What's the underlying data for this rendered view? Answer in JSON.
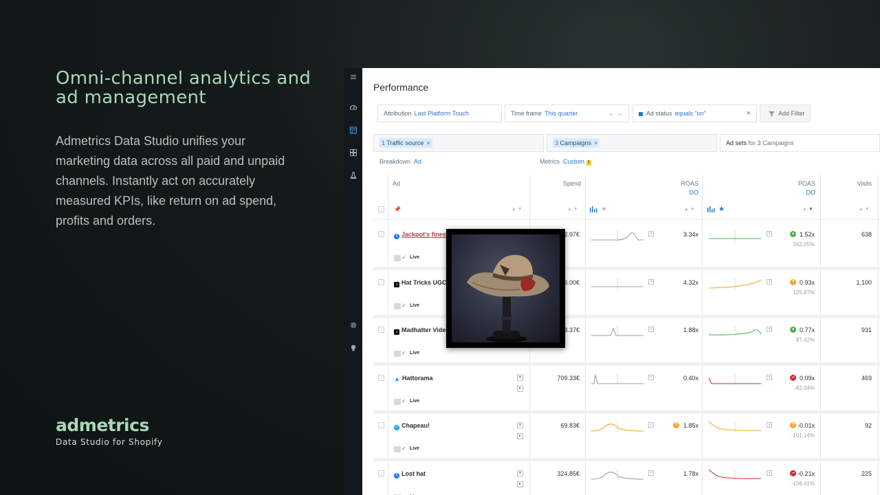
{
  "promo": {
    "headline": "Omni-channel analytics and ad management",
    "description": "Admetrics Data Studio unifies your marketing data across all paid and unpaid channels. Instantly act on accurately measured KPIs, like return on ad spend, profits and orders.",
    "brand_name": "admetrics",
    "brand_tagline": "Data Studio for Shopify",
    "accent_color": "#a8d8b9"
  },
  "sidebar": {
    "icons": [
      "menu-icon",
      "dashboard-icon",
      "calendar-icon",
      "grid-icon",
      "lab-icon",
      "settings-icon",
      "lightbulb-icon"
    ]
  },
  "page": {
    "title": "Performance"
  },
  "filters": {
    "attribution_label": "Attribution",
    "attribution_value": "Last Platform Touch",
    "timeframe_label": "Time frame",
    "timeframe_value": "This quarter",
    "timeframe_arrows": "← →",
    "adstatus_label": "Ad status",
    "adstatus_value": "equals \"on\"",
    "clear_symbol": "×",
    "add_filter_label": "Add Filter"
  },
  "selectors": {
    "traffic_count": "1",
    "traffic_label": "Traffic source",
    "campaigns_count": "3",
    "campaigns_label": "Campaigns",
    "adsets_label": "Ad sets",
    "adsets_for": "for",
    "adsets_count": "3",
    "adsets_campaigns": "Campaigns",
    "remove_symbol": "×"
  },
  "options": {
    "breakdown_label": "Breakdown",
    "breakdown_value": "Ad",
    "metrics_label": "Metrics",
    "metrics_value": "Custom",
    "warning_symbol": "!"
  },
  "table": {
    "columns": {
      "ad": "Ad",
      "spend": "Spend",
      "roas": "ROAS",
      "roas_sub": "DO",
      "poas": "POAS",
      "poas_sub": "DO",
      "visits": "Visits"
    },
    "live_label": "Live",
    "rows": [
      {
        "name": "Jackpot's finest",
        "platform": "facebook",
        "link": true,
        "spend": "482.97€",
        "roas": "3.34x",
        "roas_badge": "",
        "poas": "1.52x",
        "poas_pct": "342.05%",
        "poas_status": "green",
        "visits": "638"
      },
      {
        "name": "Hat Tricks UGC",
        "platform": "tiktok",
        "link": false,
        "spend": "406.00€",
        "roas": "4.32x",
        "roas_badge": "",
        "poas": "0.93x",
        "poas_pct": "125.87%",
        "poas_status": "orange",
        "visits": "1,100"
      },
      {
        "name": "Madhatter Video",
        "platform": "tiktok",
        "link": false,
        "spend": "398.37€",
        "roas": "1.88x",
        "roas_badge": "",
        "poas": "0.77x",
        "poas_pct": "87.42%",
        "poas_status": "green",
        "visits": "931"
      },
      {
        "name": "Hattorama",
        "platform": "google",
        "link": false,
        "spend": "709.33€",
        "roas": "0.40x",
        "roas_badge": "",
        "poas": "0.09x",
        "poas_pct": "-82.04%",
        "poas_status": "red",
        "visits": "469"
      },
      {
        "name": "Chapeau!",
        "platform": "twitter",
        "link": false,
        "spend": "69.83€",
        "roas": "1.85x",
        "roas_badge": "orange",
        "poas": "-0.01x",
        "poas_pct": "-101.14%",
        "poas_status": "orange",
        "visits": "92"
      },
      {
        "name": "Lost hat",
        "platform": "facebook",
        "link": false,
        "spend": "324.85€",
        "roas": "1.78x",
        "roas_badge": "",
        "poas": "-0.21x",
        "poas_pct": "-138.41%",
        "poas_status": "red",
        "visits": "225"
      }
    ]
  },
  "colors": {
    "link_blue": "#2f74c8",
    "link_red": "#d0304b",
    "status_green": "#4caf50",
    "status_orange": "#f5a623",
    "status_red": "#d32f2f"
  }
}
